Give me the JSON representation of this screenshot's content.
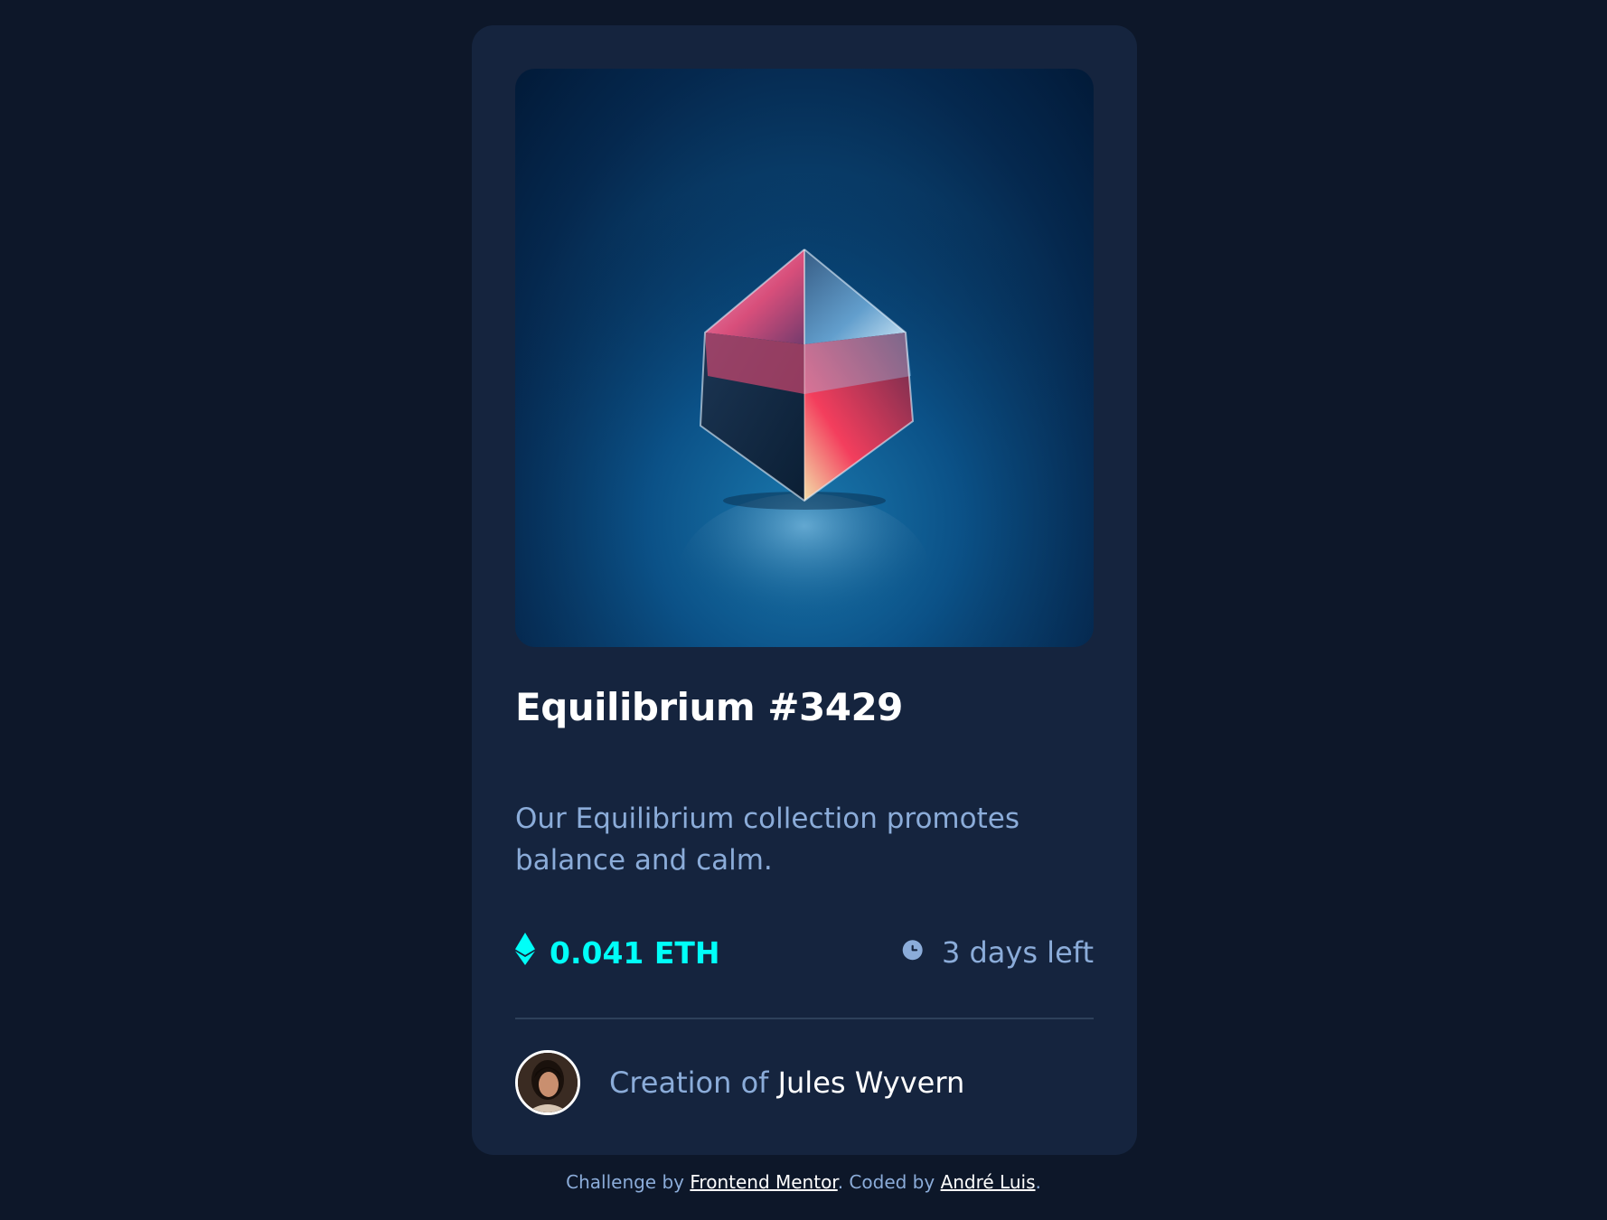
{
  "card": {
    "title": "Equilibrium #3429",
    "description": "Our Equilibrium collection promotes balance and calm.",
    "price": "0.041 ETH",
    "time_left": "3 days left",
    "creator_prefix": "Creation of ",
    "creator_name": "Jules Wyvern"
  },
  "footer": {
    "prefix": "Challenge by ",
    "link1": "Frontend Mentor",
    "middle": ". Coded by ",
    "link2": "André Luis",
    "suffix": "."
  },
  "colors": {
    "page_bg": "#0d1729",
    "card_bg": "#15243e",
    "accent_cyan": "#00fff8",
    "soft_blue": "#8bacd9",
    "white": "#ffffff",
    "divider": "#2e405a"
  },
  "icons": {
    "price": "ethereum-icon",
    "time": "clock-icon"
  }
}
